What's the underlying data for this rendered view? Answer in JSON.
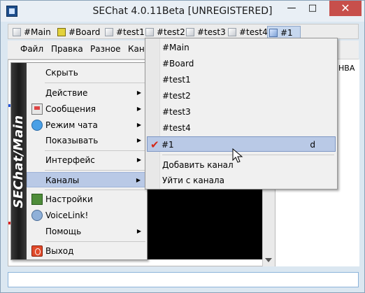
{
  "window": {
    "title": "SEChat 4.0.11Beta [UNREGISTERED]",
    "min": "—",
    "max": "□",
    "close": "✕"
  },
  "tabs": [
    {
      "label": "#Main",
      "icon": "channel-icon"
    },
    {
      "label": "#Board",
      "icon": "board-icon"
    },
    {
      "label": "#test1",
      "icon": "channel-icon"
    },
    {
      "label": "#test2",
      "icon": "channel-icon"
    },
    {
      "label": "#test3",
      "icon": "channel-icon"
    },
    {
      "label": "#test4",
      "icon": "channel-icon"
    },
    {
      "label": "#1",
      "icon": "channel-active-icon",
      "selected": true
    }
  ],
  "menubar": [
    "Файл",
    "Правка",
    "Разное",
    "Канал"
  ],
  "userlist": {
    "header": "НВА"
  },
  "main_menu": {
    "banner": "SEChat/Main",
    "items": {
      "hide": "Скрыть",
      "action": "Действие",
      "messages": "Сообщения",
      "chat_mode": "Режим чата",
      "show": "Показывать",
      "interface": "Интерфейс",
      "channels": "Каналы",
      "settings": "Настройки",
      "voicelink": "VoiceLink!",
      "help": "Помощь",
      "exit": "Выход"
    },
    "submenu_arrow": "▶"
  },
  "channels_menu": {
    "items": [
      "#Main",
      "#Board",
      "#test1",
      "#test2",
      "#test3",
      "#test4"
    ],
    "current": {
      "label": "#1",
      "check": "✔",
      "mode": "d"
    },
    "add": "Добавить канал",
    "leave": "Уйти с канала"
  },
  "colors": {
    "highlight": "#b9c9e6",
    "close_button": "#c74f4b",
    "check": "#d52a1a"
  }
}
